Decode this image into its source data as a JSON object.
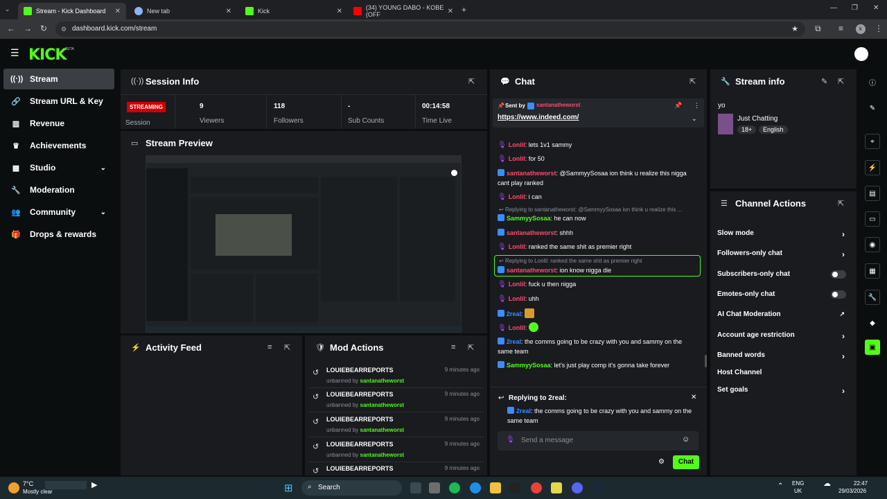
{
  "browser": {
    "tabs": [
      {
        "title": "Stream - Kick Dashboard",
        "active": true
      },
      {
        "title": "New tab",
        "active": false
      },
      {
        "title": "Kick",
        "active": false
      },
      {
        "title": "(34) YOUNG DABO - KOBE (OFF",
        "active": false
      }
    ],
    "url": "dashboard.kick.com/stream"
  },
  "brand": {
    "logo": "KICK",
    "beta": "BETA",
    "accent": "#53fc18"
  },
  "sidebar": {
    "items": [
      {
        "label": "Stream",
        "icon": "broadcast-icon"
      },
      {
        "label": "Stream URL & Key",
        "icon": "link-icon"
      },
      {
        "label": "Revenue",
        "icon": "chart-icon"
      },
      {
        "label": "Achievements",
        "icon": "trophy-icon"
      },
      {
        "label": "Studio",
        "icon": "layout-icon"
      },
      {
        "label": "Moderation",
        "icon": "wrench-icon"
      },
      {
        "label": "Community",
        "icon": "users-icon"
      },
      {
        "label": "Drops & rewards",
        "icon": "gift-icon"
      }
    ]
  },
  "session": {
    "title": "Session Info",
    "status": "STREAMING",
    "status_label": "Session",
    "viewers": {
      "value": "9",
      "label": "Viewers"
    },
    "followers": {
      "value": "118",
      "label": "Followers"
    },
    "subs": {
      "value": "-",
      "label": "Sub Counts"
    },
    "time": {
      "value": "00:14:58",
      "label": "Time Live"
    }
  },
  "preview": {
    "title": "Stream Preview"
  },
  "activity": {
    "title": "Activity Feed"
  },
  "mod_actions": {
    "title": "Mod Actions",
    "rows": [
      {
        "user": "LOUIEBEARREPORTS",
        "action": "unbanned by",
        "by": "santanatheworst",
        "time": "9 minutes ago"
      },
      {
        "user": "LOUIEBEARREPORTS",
        "action": "unbanned by",
        "by": "santanatheworst",
        "time": "9 minutes ago"
      },
      {
        "user": "LOUIEBEARREPORTS",
        "action": "unbanned by",
        "by": "santanatheworst",
        "time": "9 minutes ago"
      },
      {
        "user": "LOUIEBEARREPORTS",
        "action": "unbanned by",
        "by": "santanatheworst",
        "time": "9 minutes ago"
      },
      {
        "user": "LOUIEBEARREPORTS",
        "action": "",
        "by": "",
        "time": "9 minutes ago"
      }
    ]
  },
  "chat": {
    "title": "Chat",
    "pinned": {
      "sent_by": "Sent by",
      "user": "santanatheworst",
      "link": "https://www.indeed.com/"
    },
    "messages": [
      {
        "user": "Lonlil",
        "text": "lets 1v1 sammy"
      },
      {
        "user": "Lonlil",
        "text": "for 50"
      },
      {
        "user": "santanatheworst",
        "text": "@SammyySosaa ion think u realize this nigga cant play ranked"
      },
      {
        "user": "Lonlil",
        "text": "i can"
      },
      {
        "reply": "Replying to santanatheworst: @SammyySosaa ion think u realize this ...",
        "user": "SammyySosaa",
        "text": "he can now"
      },
      {
        "user": "santanatheworst",
        "text": "shhh"
      },
      {
        "user": "Lonlil",
        "text": "ranked the same shit as premier right"
      },
      {
        "reply": "Replying to Lonlil: ranked the same shit as premier right",
        "user": "santanatheworst",
        "text": "ion know nigga die"
      },
      {
        "user": "Lonlil",
        "text": "fuck u then nigga"
      },
      {
        "user": "Lonlil",
        "text": "uhh"
      },
      {
        "user": "2real",
        "text": ""
      },
      {
        "user": "Lonlil",
        "text": ""
      },
      {
        "user": "2real",
        "text": "the comms going to be crazy with you and sammy on the same team"
      },
      {
        "user": "SammyySosaa",
        "text": "let's just play comp it's gonna take forever"
      }
    ],
    "replying_to": "Replying to 2real:",
    "reply_user": "2real",
    "reply_text": "the comms going to be crazy with you and sammy on the same team",
    "placeholder": "Send a message",
    "send_label": "Chat"
  },
  "stream_info": {
    "title": "Stream info",
    "stream_title": "yo",
    "category": "Just Chatting",
    "tags": [
      "18+",
      "English"
    ]
  },
  "channel_actions": {
    "title": "Channel Actions",
    "items": [
      {
        "label": "Slow mode",
        "control": "chevron"
      },
      {
        "label": "Followers-only chat",
        "control": "chevron"
      },
      {
        "label": "Subscribers-only chat",
        "control": "toggle"
      },
      {
        "label": "Emotes-only chat",
        "control": "toggle"
      },
      {
        "label": "AI Chat Moderation",
        "control": "external"
      },
      {
        "label": "Account age restriction",
        "control": "chevron"
      },
      {
        "label": "Banned words",
        "control": "chevron"
      },
      {
        "label": "Host Channel",
        "control": "none"
      },
      {
        "label": "Set goals",
        "control": "chevron"
      }
    ]
  },
  "taskbar": {
    "weather_temp": "7°C",
    "weather_desc": "Mostly clear",
    "search": "Search",
    "lang": "ENG",
    "region": "UK",
    "time": "22:47",
    "date": "29/03/2026"
  }
}
